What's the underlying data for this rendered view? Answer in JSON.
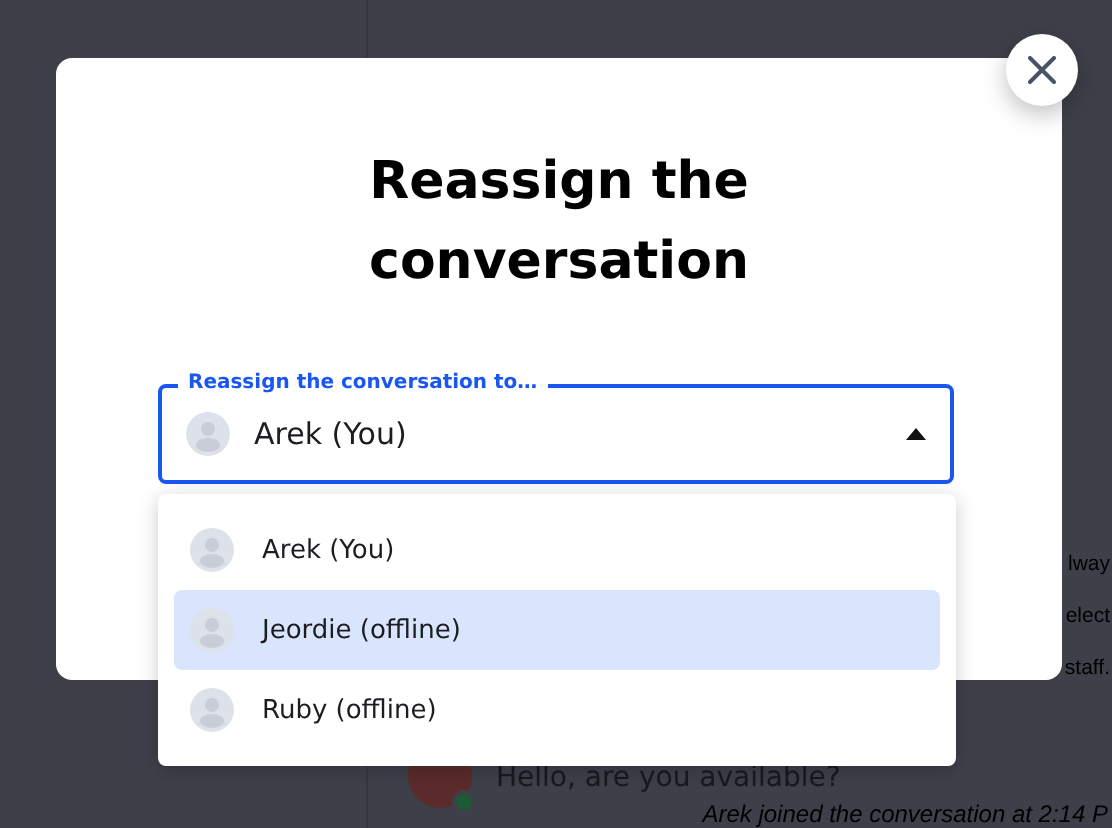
{
  "background": {
    "side_text": [
      "lway",
      "elect",
      "staff."
    ],
    "message": "Hello, are you available?",
    "event": "Arek joined the conversation at 2:14 P"
  },
  "dialog": {
    "title": "Reassign the conversation"
  },
  "select": {
    "label": "Reassign the conversation to…",
    "value": "Arek (You)",
    "expanded": true
  },
  "options": [
    {
      "label": "Arek (You)",
      "selected": false
    },
    {
      "label": "Jeordie (offline)",
      "selected": true
    },
    {
      "label": "Ruby (offline)",
      "selected": false
    }
  ]
}
